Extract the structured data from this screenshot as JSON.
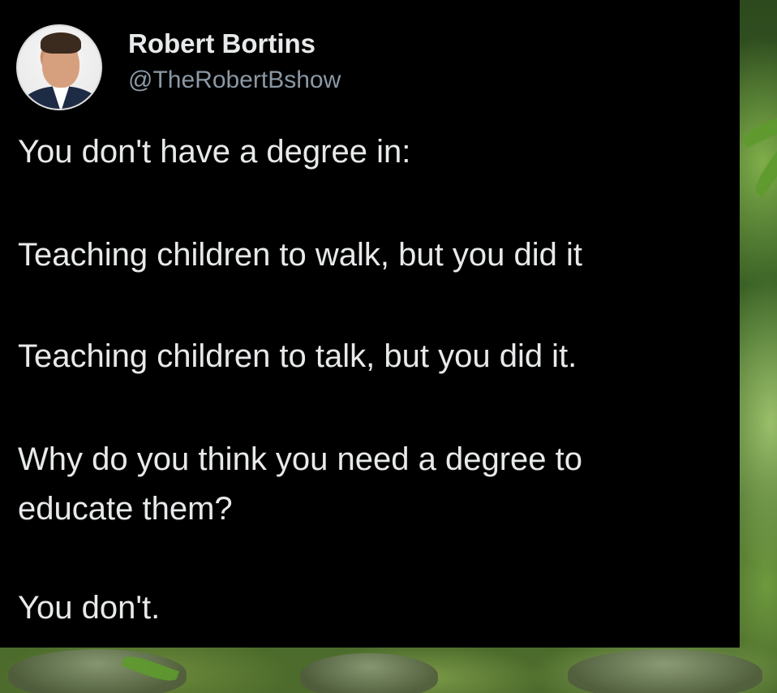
{
  "author": {
    "name": "Robert Bortins",
    "handle": "@TheRobertBshow",
    "avatar_icon": "profile-photo"
  },
  "tweet": {
    "lines": [
      "You don't have a degree in:",
      "Teaching children to walk, but you did it",
      "Teaching children to talk, but you did it.",
      "Why do you think you need a degree to",
      "educate them?",
      "You don't."
    ]
  },
  "colors": {
    "card_background": "#000000",
    "text_primary": "#e7e9ea",
    "text_secondary": "#8b98a5",
    "background_foliage": "#3f6a28"
  }
}
